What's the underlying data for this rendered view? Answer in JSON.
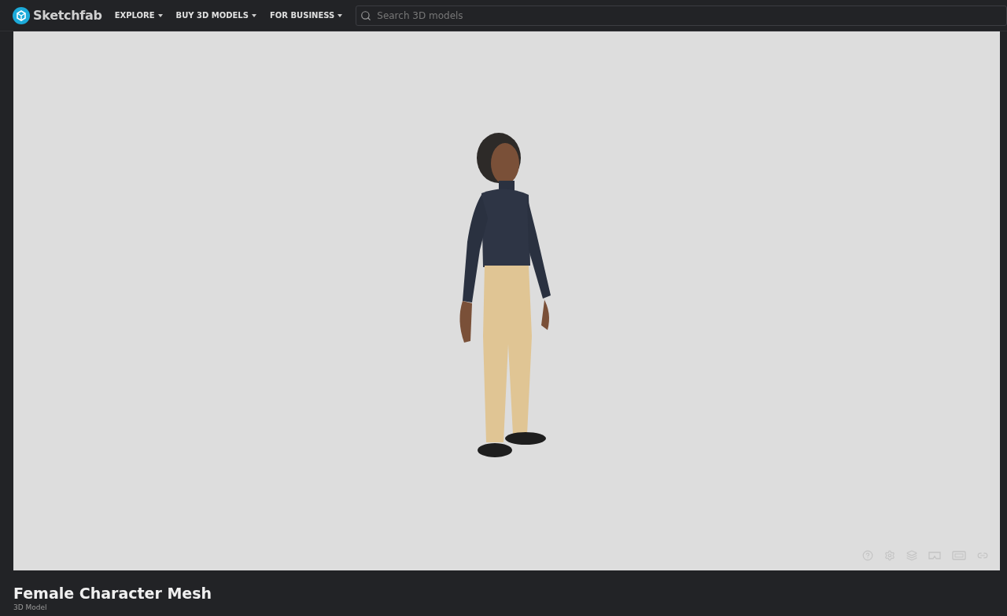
{
  "header": {
    "logo": "Sketchfab",
    "nav": [
      {
        "label": "EXPLORE"
      },
      {
        "label": "BUY 3D MODELS"
      },
      {
        "label": "FOR BUSINESS"
      }
    ],
    "search": {
      "placeholder": "Search 3D models"
    }
  },
  "model": {
    "title": "Female Character Mesh",
    "subtitle": "3D Model"
  }
}
